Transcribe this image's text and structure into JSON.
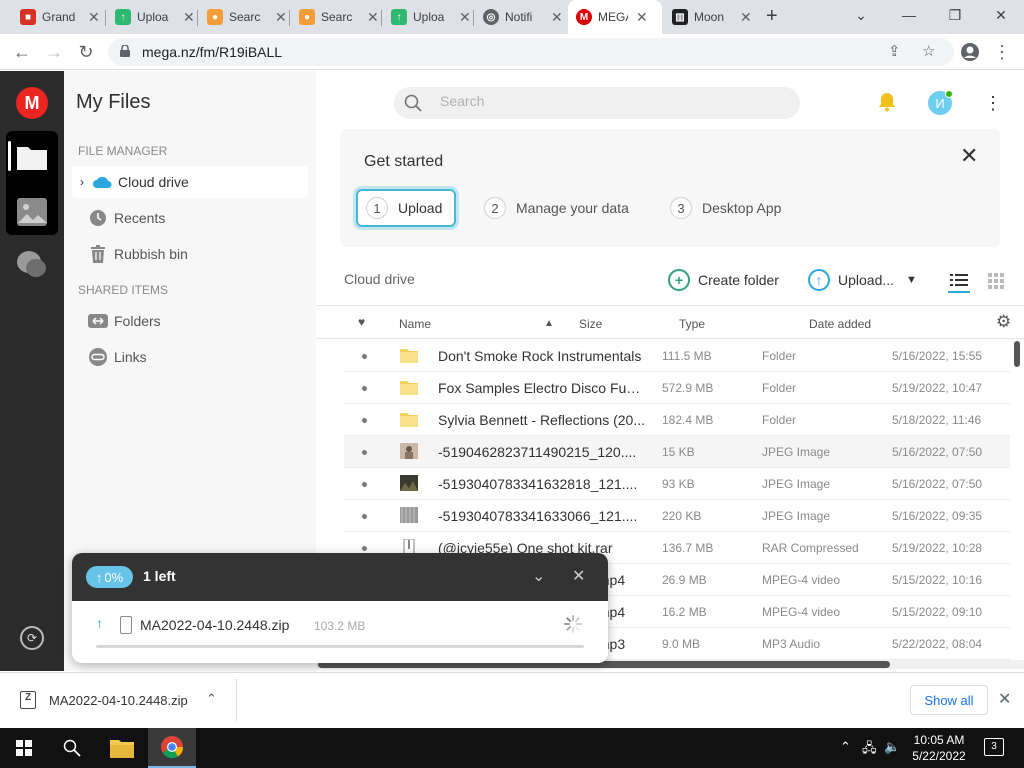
{
  "browser": {
    "tabs": [
      {
        "title": "Grand",
        "icon": "red-lock-icon",
        "color": "#d93025"
      },
      {
        "title": "Uploa",
        "icon": "cloud-upload-icon",
        "color": "#2eb872"
      },
      {
        "title": "Searc",
        "icon": "person-icon",
        "color": "#f29d38"
      },
      {
        "title": "Searc",
        "icon": "person-icon",
        "color": "#f29d38"
      },
      {
        "title": "Uploa",
        "icon": "cloud-upload-icon",
        "color": "#2eb872"
      },
      {
        "title": "Notifi",
        "icon": "globe-icon",
        "color": "#5f6368"
      },
      {
        "title": "MEGA",
        "icon": "mega-icon",
        "color": "#d90007"
      },
      {
        "title": "Moon",
        "icon": "newspaper-icon",
        "color": "#202124"
      }
    ],
    "url": "mega.nz/fm/R19iBALL"
  },
  "app": {
    "logo_letter": "M",
    "accent": "#d90007",
    "sidebar": {
      "title": "My Files",
      "sections": {
        "file_manager": "FILE MANAGER",
        "shared_items": "SHARED ITEMS"
      },
      "items": {
        "cloud_drive": "Cloud drive",
        "recents": "Recents",
        "rubbish_bin": "Rubbish bin",
        "folders": "Folders",
        "links": "Links"
      }
    },
    "header": {
      "search_placeholder": "Search",
      "avatar_letter": "И"
    },
    "get_started": {
      "title": "Get started",
      "steps": [
        {
          "num": "1",
          "label": "Upload"
        },
        {
          "num": "2",
          "label": "Manage your data"
        },
        {
          "num": "3",
          "label": "Desktop App"
        }
      ]
    },
    "toolbar": {
      "breadcrumb": "Cloud drive",
      "create_folder": "Create folder",
      "upload": "Upload..."
    },
    "table": {
      "columns": {
        "name": "Name",
        "size": "Size",
        "type": "Type",
        "date": "Date added"
      },
      "rows": [
        {
          "name": "Don't Smoke Rock Instrumentals",
          "size": "111.5 MB",
          "type": "Folder",
          "date": "5/16/2022, 15:55",
          "kind": "folder"
        },
        {
          "name": "Fox Samples Electro Disco Funk...",
          "size": "572.9 MB",
          "type": "Folder",
          "date": "5/19/2022, 10:47",
          "kind": "folder"
        },
        {
          "name": "Sylvia Bennett - Reflections (20...",
          "size": "182.4 MB",
          "type": "Folder",
          "date": "5/18/2022, 11:46",
          "kind": "folder"
        },
        {
          "name": "-5190462823711490215_120....",
          "size": "15 KB",
          "type": "JPEG Image",
          "date": "5/16/2022, 07:50",
          "kind": "image"
        },
        {
          "name": "-5193040783341632818_121....",
          "size": "93 KB",
          "type": "JPEG Image",
          "date": "5/16/2022, 07:50",
          "kind": "image"
        },
        {
          "name": "-5193040783341633066_121....",
          "size": "220 KB",
          "type": "JPEG Image",
          "date": "5/16/2022, 09:35",
          "kind": "image"
        },
        {
          "name": "(@icyie55e) One shot kit.rar",
          "size": "136.7 MB",
          "type": "RAR Compressed",
          "date": "5/19/2022, 10:28",
          "kind": "archive"
        },
        {
          "name": ".mp4",
          "size": "26.9 MB",
          "type": "MPEG-4 video",
          "date": "5/15/2022, 10:16",
          "kind": "video"
        },
        {
          "name": ".mp4",
          "size": "16.2 MB",
          "type": "MPEG-4 video",
          "date": "5/15/2022, 09:10",
          "kind": "video"
        },
        {
          "name": ".mp3",
          "size": "9.0 MB",
          "type": "MP3 Audio",
          "date": "5/22/2022, 08:04",
          "kind": "audio"
        }
      ]
    },
    "transfers": {
      "percent": "0%",
      "remaining": "1 left",
      "file_name": "MA2022-04-10.2448.zip",
      "file_size": "103.2 MB",
      "progress": 0
    }
  },
  "downloads": {
    "file_name": "MA2022-04-10.2448.zip",
    "show_all": "Show all"
  },
  "taskbar": {
    "time": "10:05 AM",
    "date": "5/22/2022",
    "notif_count": "3"
  }
}
